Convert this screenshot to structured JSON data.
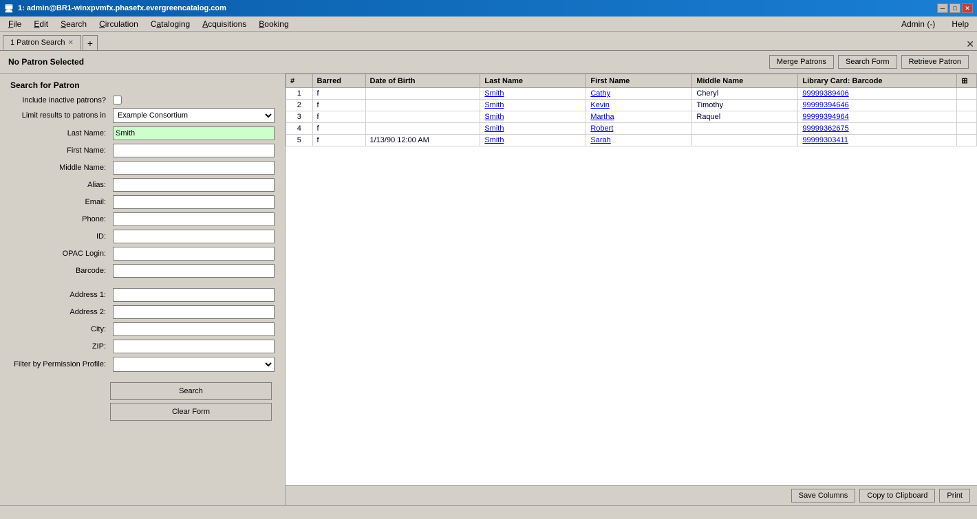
{
  "titlebar": {
    "title": "1: admin@BR1-winxpvmfx.phasefx.evergreencatalog.com",
    "min_btn": "─",
    "max_btn": "□",
    "close_btn": "✕"
  },
  "menubar": {
    "items": [
      {
        "label": "File",
        "underline_index": 0
      },
      {
        "label": "Edit",
        "underline_index": 0
      },
      {
        "label": "Search",
        "underline_index": 0
      },
      {
        "label": "Circulation",
        "underline_index": 0
      },
      {
        "label": "Cataloging",
        "underline_index": 0
      },
      {
        "label": "Acquisitions",
        "underline_index": 0
      },
      {
        "label": "Booking",
        "underline_index": 0
      }
    ],
    "admin": "Admin (-)",
    "help": "Help"
  },
  "tabs": [
    {
      "label": "1 Patron Search",
      "active": true
    }
  ],
  "tab_add": "+",
  "tab_window_close": "✕",
  "header": {
    "no_patron": "No Patron Selected",
    "merge_patrons": "Merge Patrons",
    "search_form": "Search Form",
    "retrieve_patron": "Retrieve Patron"
  },
  "search_form": {
    "title": "Search for Patron",
    "include_inactive_label": "Include inactive patrons?",
    "limit_results_label": "Limit results to patrons in",
    "limit_results_options": [
      "Example Consortium"
    ],
    "limit_results_selected": "Example Consortium",
    "last_name_label": "Last Name:",
    "last_name_value": "Smith",
    "first_name_label": "First Name:",
    "first_name_value": "",
    "middle_name_label": "Middle Name:",
    "middle_name_value": "",
    "alias_label": "Alias:",
    "alias_value": "",
    "email_label": "Email:",
    "email_value": "",
    "phone_label": "Phone:",
    "phone_value": "",
    "id_label": "ID:",
    "id_value": "",
    "opac_login_label": "OPAC Login:",
    "opac_login_value": "",
    "barcode_label": "Barcode:",
    "barcode_value": "",
    "address1_label": "Address 1:",
    "address1_value": "",
    "address2_label": "Address 2:",
    "address2_value": "",
    "city_label": "City:",
    "city_value": "",
    "zip_label": "ZIP:",
    "zip_value": "",
    "filter_label": "Filter by Permission Profile:",
    "filter_options": [
      ""
    ],
    "search_btn": "Search",
    "clear_btn": "Clear Form"
  },
  "results": {
    "columns": [
      "#",
      "Barred",
      "Date of Birth",
      "Last Name",
      "First Name",
      "Middle Name",
      "Library Card: Barcode"
    ],
    "rows": [
      {
        "num": "1",
        "barred": "f",
        "dob": "",
        "last_name": "Smith",
        "first_name": "Cathy",
        "middle_name": "Cheryl",
        "barcode": "99999389406"
      },
      {
        "num": "2",
        "barred": "f",
        "dob": "",
        "last_name": "Smith",
        "first_name": "Kevin",
        "middle_name": "Timothy",
        "barcode": "99999394646"
      },
      {
        "num": "3",
        "barred": "f",
        "dob": "",
        "last_name": "Smith",
        "first_name": "Martha",
        "middle_name": "Raquel",
        "barcode": "99999394964"
      },
      {
        "num": "4",
        "barred": "f",
        "dob": "",
        "last_name": "Smith",
        "first_name": "Robert",
        "middle_name": "",
        "barcode": "99999362675"
      },
      {
        "num": "5",
        "barred": "f",
        "dob": "1/13/90 12:00 AM",
        "last_name": "Smith",
        "first_name": "Sarah",
        "middle_name": "",
        "barcode": "99999303411"
      }
    ]
  },
  "footer": {
    "save_columns": "Save Columns",
    "copy_clipboard": "Copy to Clipboard",
    "print": "Print"
  }
}
